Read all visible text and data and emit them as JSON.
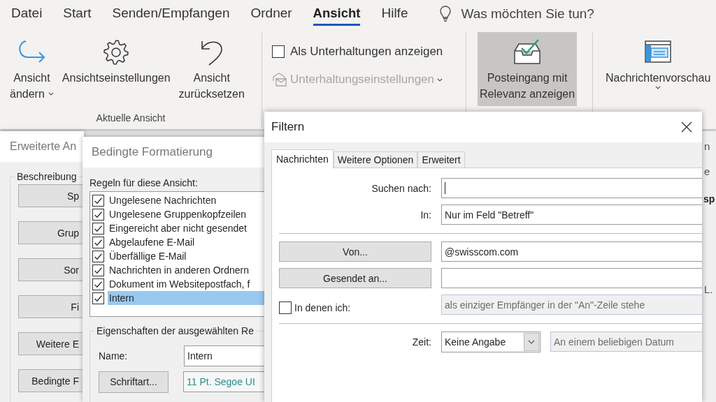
{
  "menu_tabs": [
    {
      "label": "Datei",
      "selected": false
    },
    {
      "label": "Start",
      "selected": false
    },
    {
      "label": "Senden/Empfangen",
      "selected": false
    },
    {
      "label": "Ordner",
      "selected": false
    },
    {
      "label": "Ansicht",
      "selected": true
    },
    {
      "label": "Hilfe",
      "selected": false
    }
  ],
  "tell_me": {
    "text": "Was möchten Sie tun?"
  },
  "ribbon": {
    "groups": [
      {
        "label": "Aktuelle Ansicht",
        "items": [
          {
            "kind": "large",
            "lines": [
              "Ansicht",
              "ändern"
            ],
            "dropdown": true,
            "selected": false
          },
          {
            "kind": "large",
            "lines": [
              "Ansichtseinstellungen"
            ],
            "dropdown": false,
            "selected": false
          },
          {
            "kind": "large",
            "lines": [
              "Ansicht",
              "zurücksetzen"
            ],
            "dropdown": false,
            "selected": false
          }
        ]
      },
      {
        "items": [
          {
            "kind": "checkbox",
            "label": "Als Unterhaltungen anzeigen",
            "checked": false
          },
          {
            "kind": "small",
            "label": "Unterhaltungseinstellungen",
            "dropdown": true,
            "disabled": true
          }
        ]
      },
      {
        "items": [
          {
            "kind": "large",
            "lines": [
              "Posteingang mit",
              "Relevanz anzeigen"
            ],
            "dropdown": false,
            "selected": true
          }
        ]
      },
      {
        "items": [
          {
            "kind": "large",
            "lines": [
              "Nachrichtenvorschau"
            ],
            "dropdown": true,
            "selected": false
          }
        ]
      }
    ]
  },
  "advanced_view_dialog": {
    "title": "Erweiterte An",
    "group_label": "Beschreibung",
    "buttons": [
      "Sp",
      "Grup",
      "Sor",
      "Fi",
      "Weitere E",
      "Bedingte F"
    ]
  },
  "conditional_formatting_dialog": {
    "title": "Bedingte Formatierung",
    "rules_label": "Regeln für diese Ansicht:",
    "rules": [
      {
        "label": "Ungelesene Nachrichten",
        "checked": true,
        "selected": false
      },
      {
        "label": "Ungelesene Gruppenkopfzeilen",
        "checked": true,
        "selected": false
      },
      {
        "label": "Eingereicht aber nicht gesendet",
        "checked": true,
        "selected": false
      },
      {
        "label": "Abgelaufene E-Mail",
        "checked": true,
        "selected": false
      },
      {
        "label": "Überfällige E-Mail",
        "checked": true,
        "selected": false
      },
      {
        "label": "Nachrichten in anderen Ordnern",
        "checked": true,
        "selected": false
      },
      {
        "label": "Dokument im Websitepostfach, f",
        "checked": true,
        "selected": false
      },
      {
        "label": "Intern",
        "checked": true,
        "selected": true
      }
    ],
    "properties_label": "Eigenschaften der ausgewählten Re",
    "name_label": "Name:",
    "name_value": "Intern",
    "font_button": "Schriftart...",
    "font_value": "11 Pt. Segoe UI"
  },
  "filter_dialog": {
    "title": "Filtern",
    "tabs": [
      {
        "label": "Nachrichten",
        "selected": true
      },
      {
        "label": "Weitere Optionen",
        "selected": false
      },
      {
        "label": "Erweitert",
        "selected": false
      }
    ],
    "search_label": "Suchen nach:",
    "in_label": "In:",
    "in_value": "Nur im Feld \"Betreff\"",
    "from_button": "Von...",
    "from_value": "@swisscom.com",
    "sent_to_button": "Gesendet an...",
    "recipient_checkbox": {
      "label": "In denen ich:",
      "checked": false
    },
    "recipient_value": "als einziger Empfänger in der \"An\"-Zeile stehe",
    "time_label": "Zeit:",
    "time_value": "Keine Angabe",
    "date_value": "An einem beliebigen Datum"
  },
  "background_window": {
    "fragments": [
      "n",
      "e",
      "sp",
      "L."
    ]
  }
}
